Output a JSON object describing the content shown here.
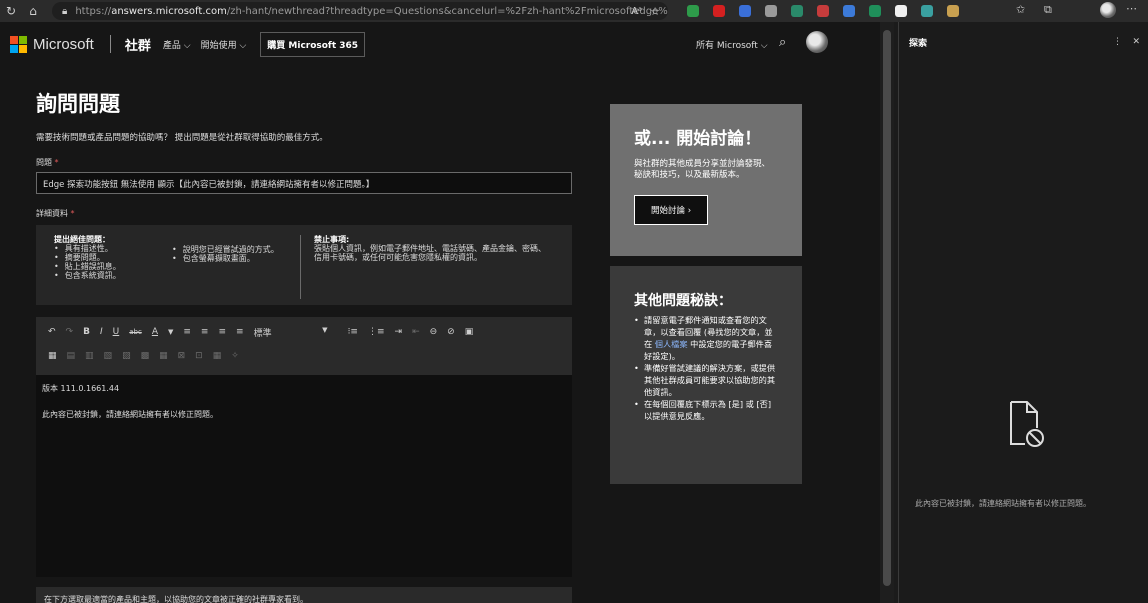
{
  "browser": {
    "url_prefix": "https://",
    "url_host": "answers.microsoft.com",
    "url_rest": "/zh-hant/newthread?threadtype=Questions&cancelurl=%2Fzh-hant%2Fmicrosoftedge%2Ffor...",
    "read_aloud": "Aᵃ",
    "extension_colors": [
      "#2e9b4a",
      "#d42020",
      "#3a6fd8",
      "#9a9a9a",
      "#2a8a6a",
      "#c63c3c",
      "#3c7ad8",
      "#1f8f5a",
      "#f0f0f0",
      "#3aa0a0",
      "#c8a050"
    ]
  },
  "header": {
    "brand": "Microsoft",
    "community": "社群",
    "nav": [
      "產品",
      "開始使用"
    ],
    "buy_label": "購買 Microsoft 365",
    "all_ms": "所有 Microsoft"
  },
  "form": {
    "title": "詢問問題",
    "subtitle": "需要技術問題或產品問題的協助嗎？ 提出問題是從社群取得協助的最佳方式。",
    "question_label": "問題",
    "question_value": "Edge 探索功能按鈕 無法使用 顯示【此內容已被封鎖，請連絡網站擁有者以修正問題。】",
    "details_label": "詳細資料",
    "tips": {
      "good_title": "提出絕佳問題：",
      "good_items": [
        "具有描述性。",
        "摘要問題。",
        "貼上錯誤訊息。",
        "包含系統資訊。"
      ],
      "good_items2": [
        "說明您已經嘗試過的方式。",
        "包含螢幕擷取畫面。"
      ],
      "bad_title": "禁止事項:",
      "bad_text": "張貼個人資訊，例如電子郵件地址、電話號碼、產品金鑰、密碼、信用卡號碼，或任何可能危害您隱私權的資訊。"
    },
    "editor": {
      "format_label": "標準",
      "line1": "版本 111.0.1661.44",
      "line2": "此內容已被封鎖，請連絡網站擁有者以修正問題。"
    },
    "bottom_text": "在下方選取最適當的產品和主題，以協助您的文章被正確的社群專家看到。"
  },
  "cards": {
    "discuss_title": "或... 開始討論！",
    "discuss_desc": "與社群的其他成員分享並討論發現、秘訣和技巧，以及最新版本。",
    "discuss_button": "開始討論 ›",
    "tips_title": "其他問題秘訣：",
    "tip1_a": "請留意電子郵件通知或查看您的文章，以查看回覆 (尋找您的文章，並在 ",
    "tip1_link": "個人檔案",
    "tip1_b": " 中設定您的電子郵件喜好設定)。",
    "tip2": "準備好嘗試建議的解決方案，或提供其他社群成員可能要求以協助您的其他資訊。",
    "tip3": "在每個回覆底下標示為 [是] 或 [否] 以提供意見反應。"
  },
  "sidepanel": {
    "title": "探索",
    "more": "⋮",
    "close": "✕",
    "message": "此內容已被封鎖，請連絡網站擁有者以修正問題。"
  }
}
